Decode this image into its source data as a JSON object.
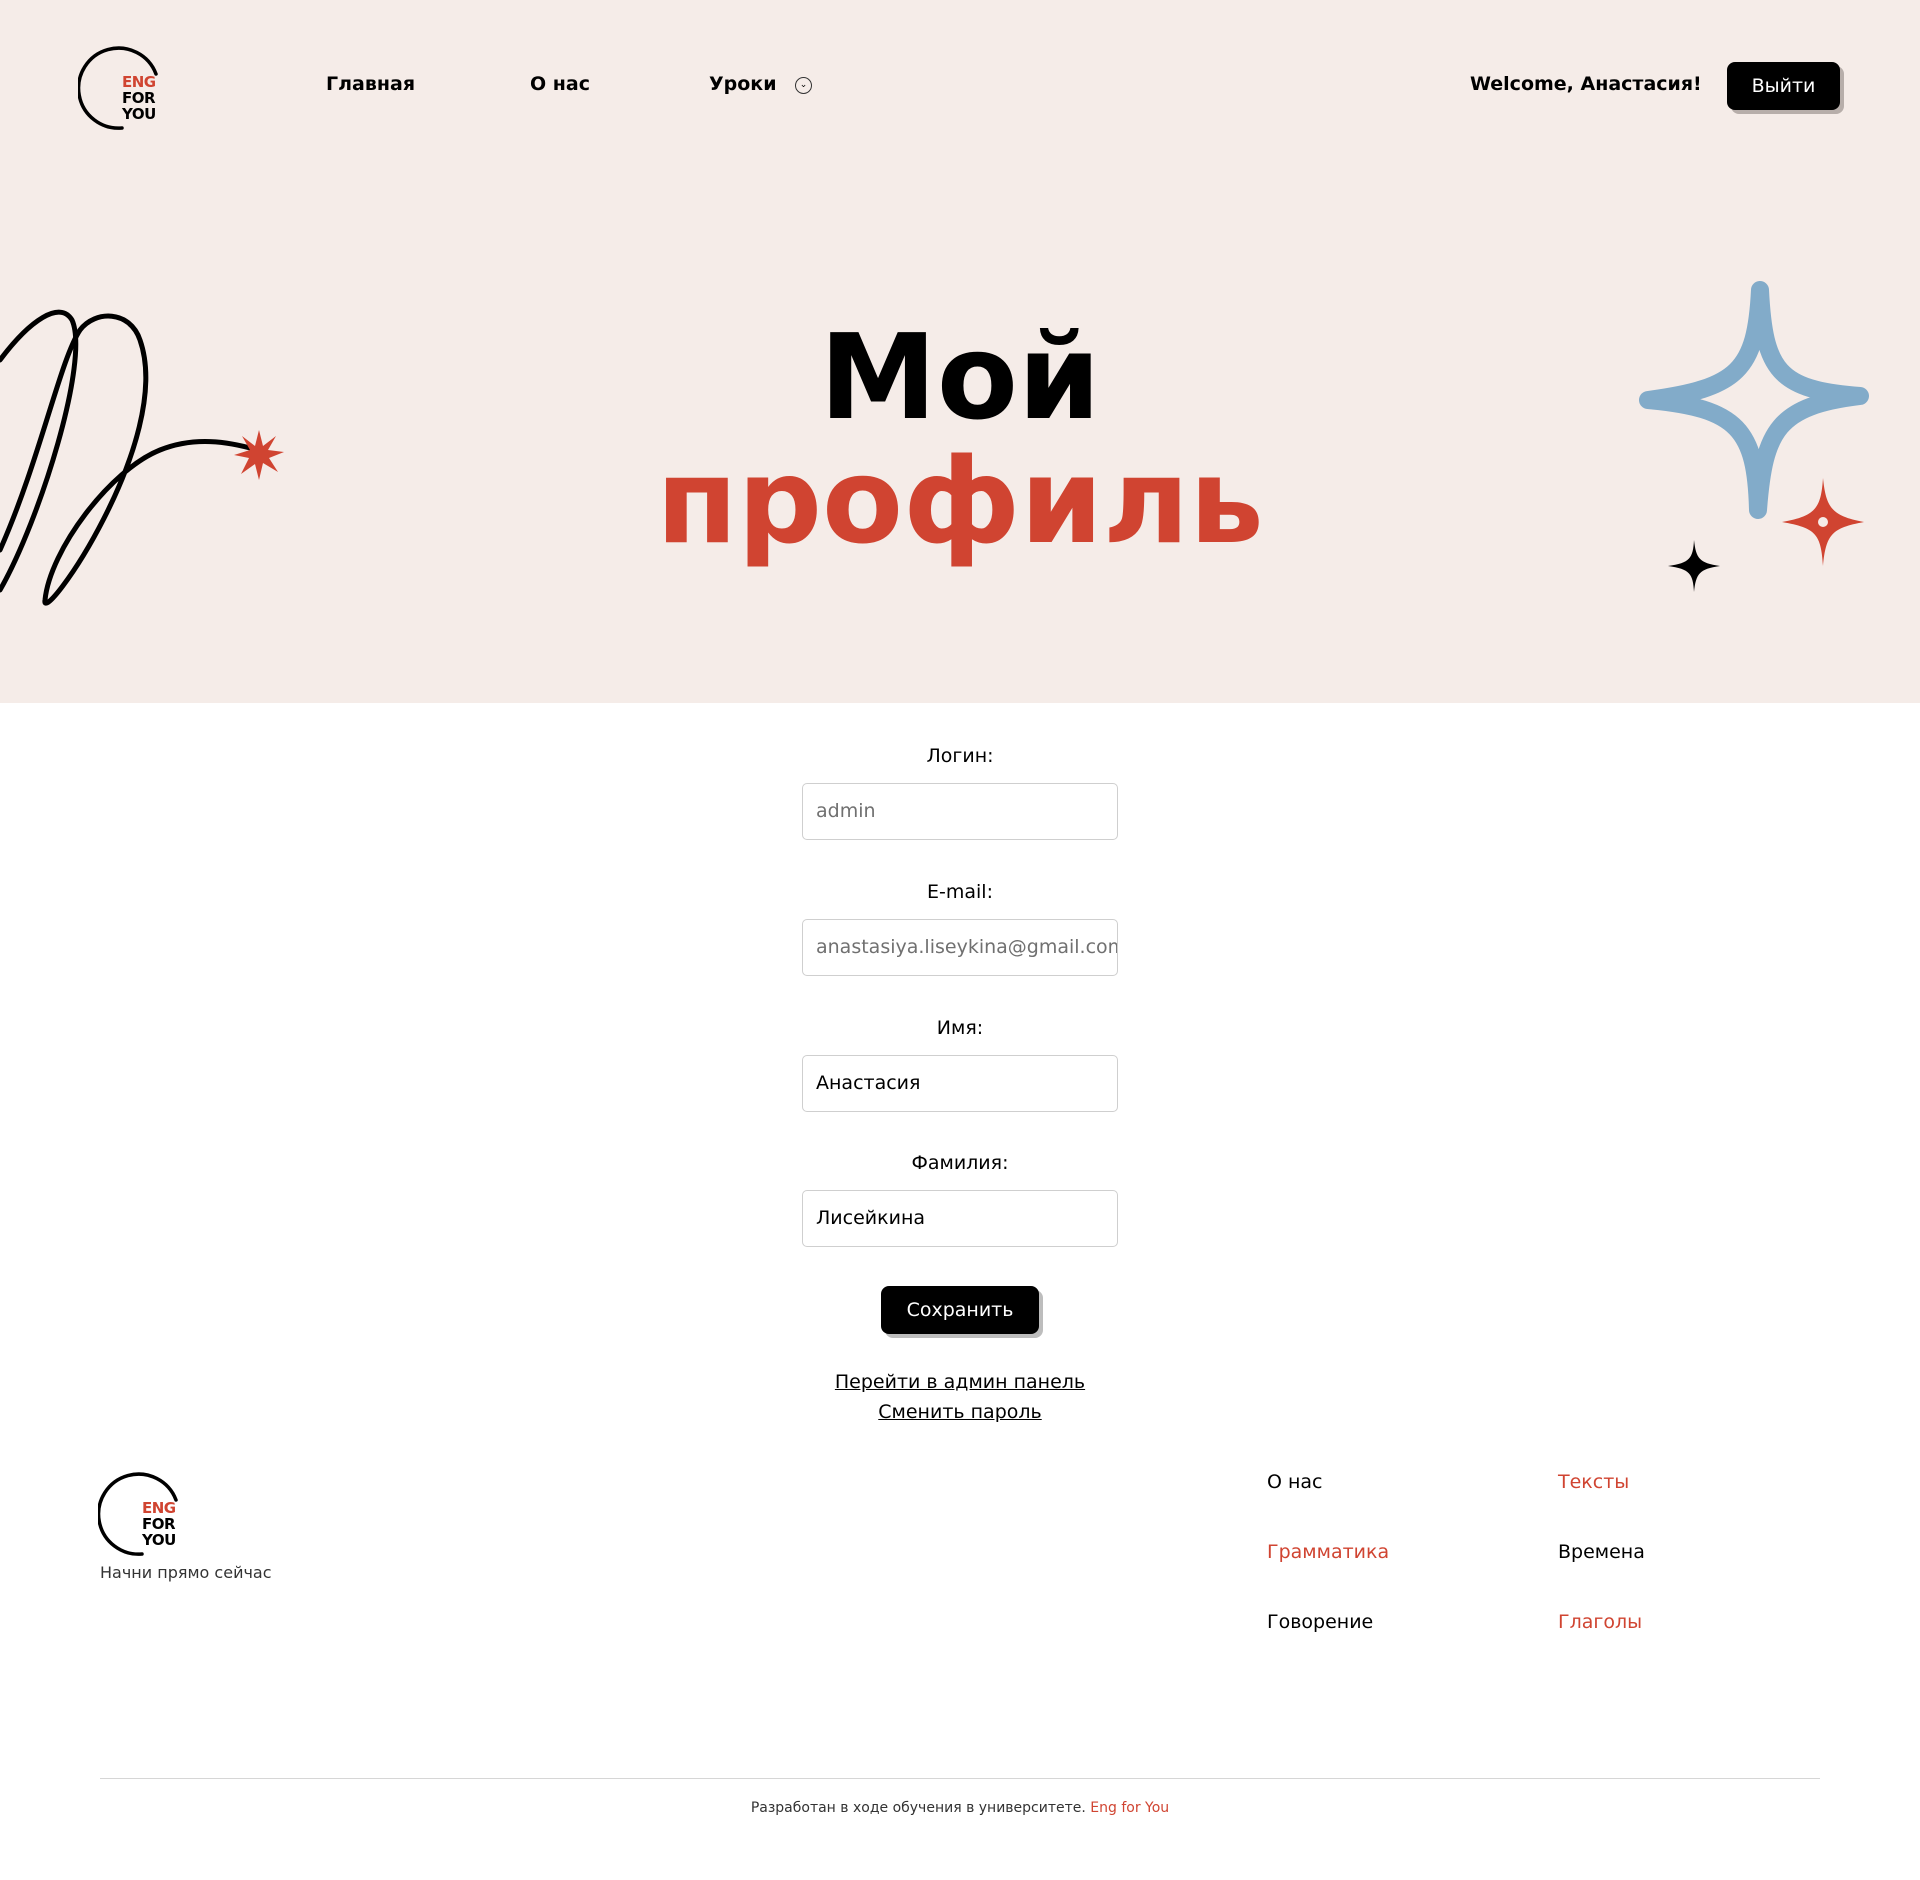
{
  "header": {
    "logo": {
      "line1": "ENG",
      "line2": "FOR",
      "line3": "YOU"
    },
    "nav": [
      {
        "label": "Главная"
      },
      {
        "label": "О нас"
      },
      {
        "label": "Уроки"
      }
    ],
    "welcome": "Welcome, Анастасия!",
    "logout_label": "Выйти"
  },
  "hero": {
    "title_line1": "Мой",
    "title_line2": "профиль"
  },
  "form": {
    "login_label": "Логин:",
    "login_value": "admin",
    "email_label": "E-mail:",
    "email_value": "anastasiya.liseykina@gmail.com",
    "first_name_label": "Имя:",
    "first_name_value": "Анастасия",
    "last_name_label": "Фамилия:",
    "last_name_value": "Лисейкина",
    "save_label": "Сохранить",
    "admin_link": "Перейти в админ панель",
    "password_link": "Сменить пароль"
  },
  "footer": {
    "logo": {
      "line1": "ENG",
      "line2": "FOR",
      "line3": "YOU"
    },
    "tagline": "Начни прямо сейчас",
    "links": [
      {
        "label": "О нас"
      },
      {
        "label": "Тексты"
      },
      {
        "label": "Грамматика"
      },
      {
        "label": "Времена"
      },
      {
        "label": "Говорение"
      },
      {
        "label": "Глаголы"
      }
    ],
    "copyright_text": "Разработан в ходе обучения в университете.",
    "copyright_brand": "Eng for You"
  },
  "colors": {
    "hero_bg": "#f5ece8",
    "accent_red": "#d04431",
    "sparkle_blue": "#82abc9",
    "button_black": "#000000"
  },
  "icons": [
    "chevron-down-icon",
    "squiggle-decoration",
    "star-burst-icon",
    "sparkle-icon"
  ]
}
